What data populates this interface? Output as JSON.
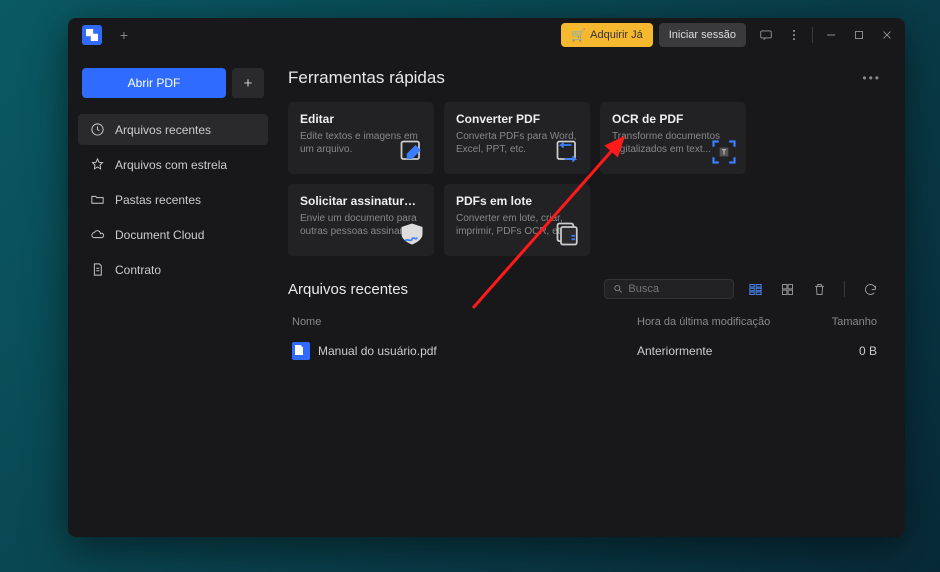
{
  "titlebar": {
    "buy_label": "Adquirir Já",
    "login_label": "Iniciar sessão"
  },
  "sidebar": {
    "open_label": "Abrir PDF",
    "items": [
      {
        "label": "Arquivos recentes"
      },
      {
        "label": "Arquivos com estrela"
      },
      {
        "label": "Pastas recentes"
      },
      {
        "label": "Document Cloud"
      },
      {
        "label": "Contrato"
      }
    ]
  },
  "main": {
    "quick_tools_title": "Ferramentas rápidas",
    "cards": [
      {
        "title": "Editar",
        "desc": "Edite textos e imagens em um arquivo."
      },
      {
        "title": "Converter PDF",
        "desc": "Converta PDFs para Word, Excel, PPT, etc."
      },
      {
        "title": "OCR de PDF",
        "desc": "Transforme documentos digitalizados em text..."
      },
      {
        "title": "Solicitar assinatura elet...",
        "desc": "Envie um documento para outras pessoas assinarem."
      },
      {
        "title": "PDFs em lote",
        "desc": "Converter em lote, criar, imprimir, PDFs OCR, etc."
      }
    ],
    "recent_title": "Arquivos recentes",
    "search_placeholder": "Busca",
    "columns": {
      "name": "Nome",
      "modified": "Hora da última modificação",
      "size": "Tamanho"
    },
    "rows": [
      {
        "name": "Manual do usuário.pdf",
        "modified": "Anteriormente",
        "size": "0 B"
      }
    ]
  }
}
